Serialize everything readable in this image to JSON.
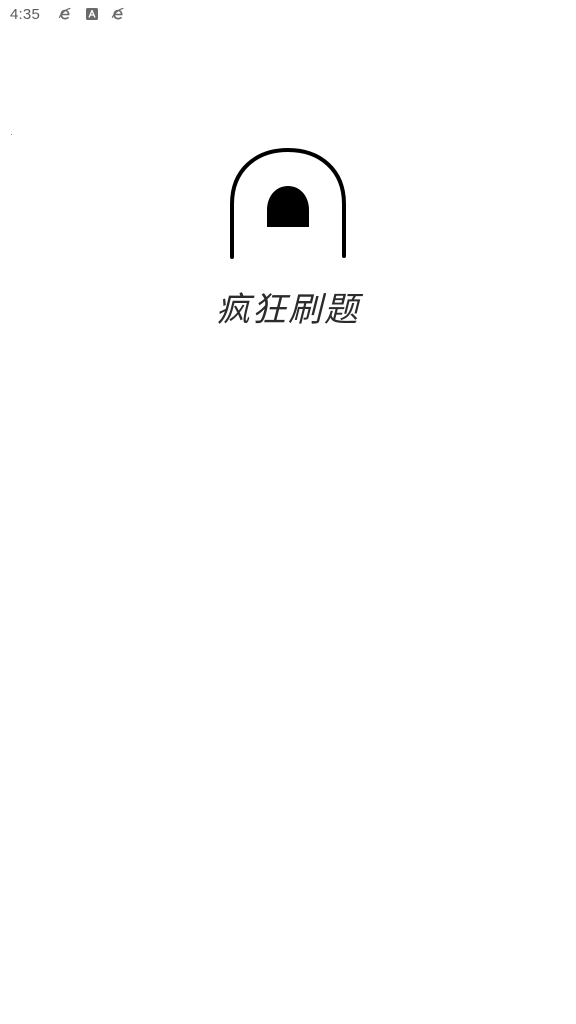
{
  "status_bar": {
    "time": "4:35",
    "icons": [
      "browser-e-icon",
      "app-store-a-icon",
      "browser-e-icon"
    ]
  },
  "splash": {
    "title": "疯狂刷题",
    "logo": "arch-logo-icon"
  },
  "colors": {
    "background": "#ffffff",
    "logo": "#000000",
    "status_text": "#5b5b5b",
    "title": "#2b2b2b"
  }
}
